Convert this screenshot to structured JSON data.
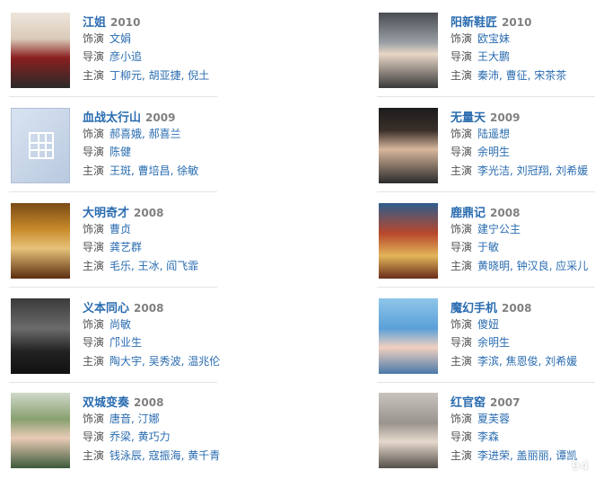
{
  "labels": {
    "role": "饰演",
    "director": "导演",
    "cast": "主演"
  },
  "films": [
    {
      "title": "江姐",
      "year": "2010",
      "role": "文娟",
      "director": "彦小追",
      "cast": "丁柳元, 胡亚捷, 倪土",
      "poster": "jiangjie"
    },
    {
      "title": "阳新鞋匠",
      "year": "2010",
      "role": "欧宝妹",
      "director": "王大鹏",
      "cast": "秦沛, 曹征, 宋茶茶",
      "poster": "shoemaker"
    },
    {
      "title": "血战太行山",
      "year": "2009",
      "role": "郝喜娥, 郝喜兰",
      "director": "陈健",
      "cast": "王斑, 曹培昌, 徐敏",
      "poster": "placeholder"
    },
    {
      "title": "无量天",
      "year": "2009",
      "role": "陆遥想",
      "director": "余明生",
      "cast": "李光洁, 刘冠翔, 刘希媛",
      "poster": "wuliangtian"
    },
    {
      "title": "大明奇才",
      "year": "2008",
      "role": "曹贞",
      "director": "龚艺群",
      "cast": "毛乐, 王冰, 阎飞霏",
      "poster": "daming"
    },
    {
      "title": "鹿鼎记",
      "year": "2008",
      "role": "建宁公主",
      "director": "于敏",
      "cast": "黄晓明, 钟汉良, 应采儿",
      "poster": "ludingji"
    },
    {
      "title": "义本同心",
      "year": "2008",
      "role": "尚敏",
      "director": "邝业生",
      "cast": "陶大宇, 吴秀波, 温兆伦",
      "poster": "yiben"
    },
    {
      "title": "魔幻手机",
      "year": "2008",
      "role": "傻妞",
      "director": "余明生",
      "cast": "李滨, 焦恩俊, 刘希媛",
      "poster": "mohuan"
    },
    {
      "title": "双城变奏",
      "year": "2008",
      "role": "唐音, 汀娜",
      "director": "乔梁, 黄巧力",
      "cast": "钱泳辰, 寇振海, 黄千青",
      "poster": "shuangcheng"
    },
    {
      "title": "红官窑",
      "year": "2007",
      "role": "夏芙蓉",
      "director": "李森",
      "cast": "李进荣, 盖丽丽, 谭凯",
      "poster": "hongguanyao"
    }
  ],
  "watermark": "94"
}
